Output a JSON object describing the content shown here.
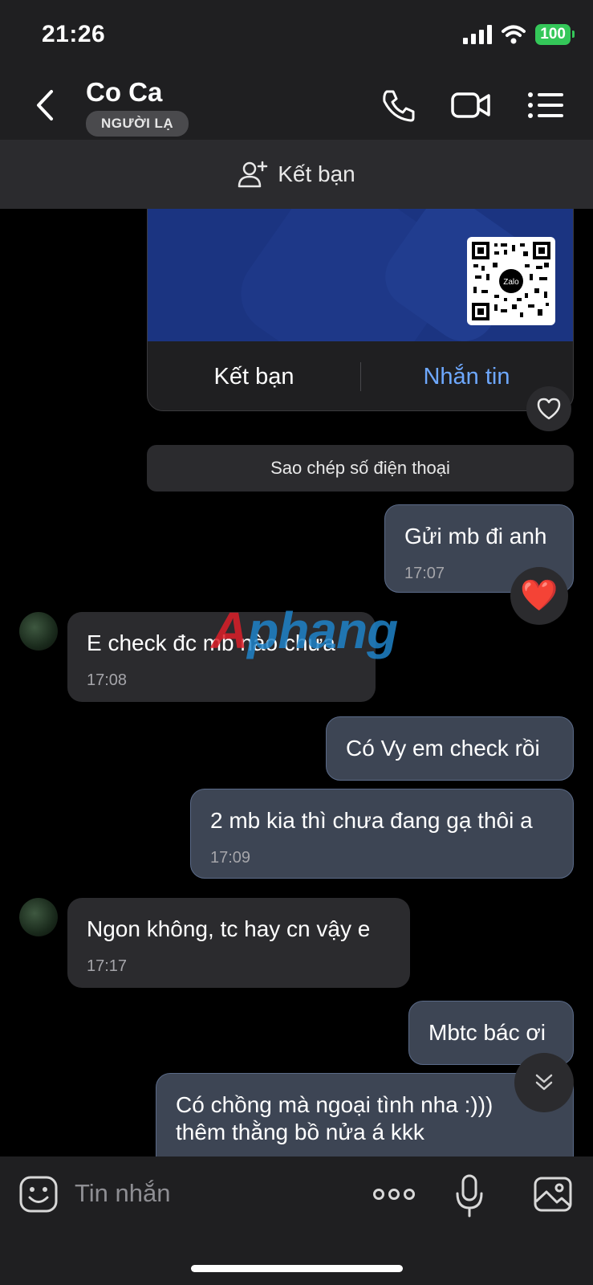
{
  "status_bar": {
    "time": "21:26",
    "battery": "100"
  },
  "header": {
    "title": "Co Ca",
    "badge": "NGƯỜI LẠ"
  },
  "add_friend_bar": {
    "label": "Kết bạn"
  },
  "card": {
    "add_friend": "Kết bạn",
    "message": "Nhắn tin",
    "qr_logo": "Zalo"
  },
  "copy_phone": "Sao chép số điện thoại",
  "watermark": {
    "part1": "A",
    "part2": "phang"
  },
  "messages": [
    {
      "direction": "out",
      "text": "Gửi mb đi anh",
      "time": "17:07",
      "reaction": "❤️"
    },
    {
      "direction": "in",
      "text": "E check đc mb nào chưa",
      "time": "17:08"
    },
    {
      "direction": "out",
      "text": "Có Vy em check rồi"
    },
    {
      "direction": "out",
      "text": "2 mb kia thì chưa đang gạ thôi a",
      "time": "17:09"
    },
    {
      "direction": "in",
      "text": "Ngon không, tc hay cn vậy e",
      "time": "17:17"
    },
    {
      "direction": "out",
      "text": "Mbtc bác ơi"
    },
    {
      "direction": "out",
      "text_line1": "Có chồng mà ngoại tình nha :)))",
      "text_line2": "thêm thằng bồ nửa á kkk"
    }
  ],
  "input": {
    "placeholder": "Tin nhắn"
  },
  "icons": [
    "back-icon",
    "phone-icon",
    "video-call-icon",
    "menu-list-icon",
    "add-user-icon",
    "heart-icon",
    "chevron-down-icon",
    "emoji-icon",
    "more-icon",
    "microphone-icon",
    "image-icon"
  ]
}
